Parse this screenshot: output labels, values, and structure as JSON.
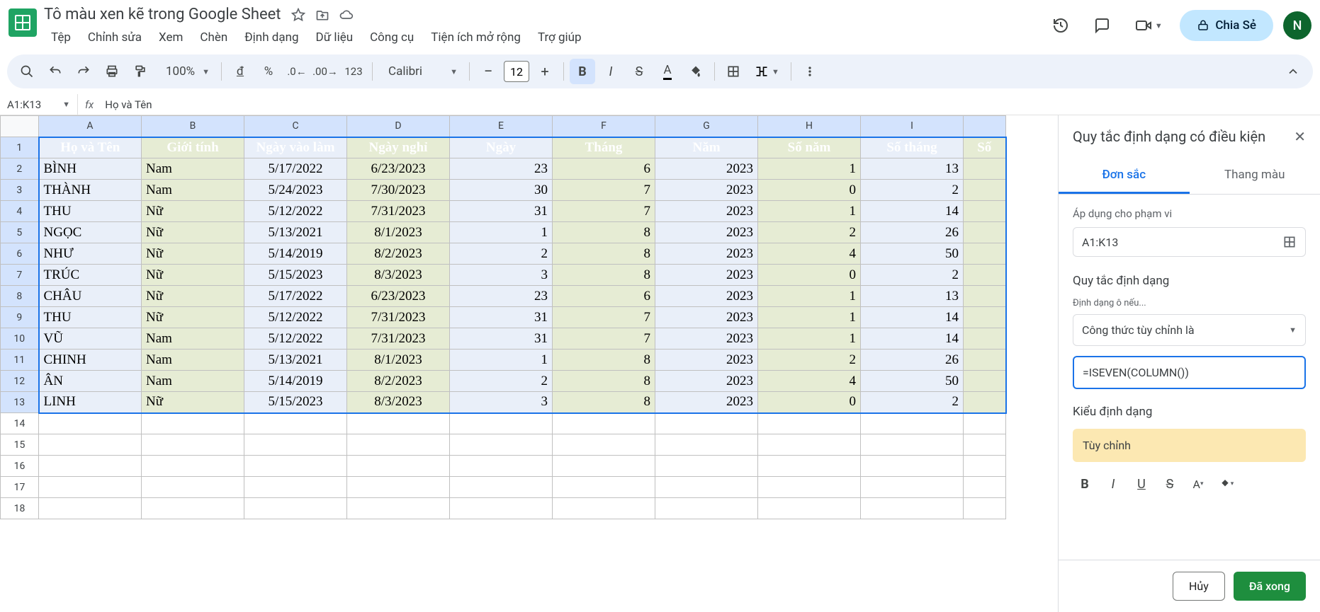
{
  "doc_title": "Tô màu xen kẽ trong Google Sheet",
  "menubar": [
    "Tệp",
    "Chỉnh sửa",
    "Xem",
    "Chèn",
    "Định dạng",
    "Dữ liệu",
    "Công cụ",
    "Tiện ích mở rộng",
    "Trợ giúp"
  ],
  "share_label": "Chia Sẻ",
  "avatar_letter": "N",
  "toolbar": {
    "zoom": "100%",
    "font": "Calibri",
    "font_size": "12"
  },
  "namebox": "A1:K13",
  "fx_value": "Họ và Tên",
  "columns": [
    "A",
    "B",
    "C",
    "D",
    "E",
    "F",
    "G",
    "H",
    "I"
  ],
  "headers": [
    "Họ và Tên",
    "Giới tính",
    "Ngày vào làm",
    "Ngày nghỉ",
    "Ngày",
    "Tháng",
    "Năm",
    "Số năm",
    "Số tháng"
  ],
  "last_header_partial": "Số",
  "rows": [
    [
      "BÌNH",
      "Nam",
      "5/17/2022",
      "6/23/2023",
      "23",
      "6",
      "2023",
      "1",
      "13"
    ],
    [
      "THÀNH",
      "Nam",
      "5/24/2023",
      "7/30/2023",
      "30",
      "7",
      "2023",
      "0",
      "2"
    ],
    [
      "THU",
      "Nữ",
      "5/12/2022",
      "7/31/2023",
      "31",
      "7",
      "2023",
      "1",
      "14"
    ],
    [
      "NGỌC",
      "Nữ",
      "5/13/2021",
      "8/1/2023",
      "1",
      "8",
      "2023",
      "2",
      "26"
    ],
    [
      "NHƯ",
      "Nữ",
      "5/14/2019",
      "8/2/2023",
      "2",
      "8",
      "2023",
      "4",
      "50"
    ],
    [
      "TRÚC",
      "Nữ",
      "5/15/2023",
      "8/3/2023",
      "3",
      "8",
      "2023",
      "0",
      "2"
    ],
    [
      "CHÂU",
      "Nữ",
      "5/17/2022",
      "6/23/2023",
      "23",
      "6",
      "2023",
      "1",
      "13"
    ],
    [
      "THU",
      "Nữ",
      "5/12/2022",
      "7/31/2023",
      "31",
      "7",
      "2023",
      "1",
      "14"
    ],
    [
      "VŨ",
      "Nam",
      "5/12/2022",
      "7/31/2023",
      "31",
      "7",
      "2023",
      "1",
      "14"
    ],
    [
      "CHINH",
      "Nam",
      "5/13/2021",
      "8/1/2023",
      "1",
      "8",
      "2023",
      "2",
      "26"
    ],
    [
      "ÂN",
      "Nam",
      "5/14/2019",
      "8/2/2023",
      "2",
      "8",
      "2023",
      "4",
      "50"
    ],
    [
      "LINH",
      "Nữ",
      "5/15/2023",
      "8/3/2023",
      "3",
      "8",
      "2023",
      "0",
      "2"
    ]
  ],
  "panel": {
    "title": "Quy tắc định dạng có điều kiện",
    "tab_single": "Đơn sắc",
    "tab_scale": "Thang màu",
    "apply_label": "Áp dụng cho phạm vi",
    "range": "A1:K13",
    "rules_title": "Quy tắc định dạng",
    "format_if": "Định dạng ô nếu...",
    "condition": "Công thức tùy chỉnh là",
    "formula": "=ISEVEN(COLUMN())",
    "style_title": "Kiểu định dạng",
    "style_preview": "Tùy chỉnh",
    "cancel": "Hủy",
    "done": "Đã xong"
  }
}
